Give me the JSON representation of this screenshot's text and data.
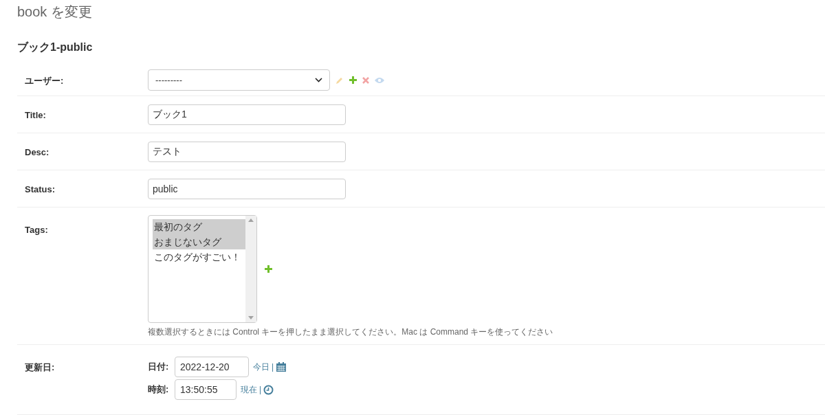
{
  "page_title": "book を変更",
  "section_title": "ブック1-public",
  "fields": [
    {
      "kind": "select",
      "label": "ユーザー:",
      "value": "---------"
    },
    {
      "kind": "text",
      "label": "Title:",
      "value": "ブック1"
    },
    {
      "kind": "text",
      "label": "Desc:",
      "value": "テスト"
    },
    {
      "kind": "text",
      "label": "Status:",
      "value": "public"
    },
    {
      "kind": "multiselect",
      "label": "Tags:",
      "options": [
        {
          "label": "最初のタグ",
          "selected": true
        },
        {
          "label": "おまじないタグ",
          "selected": true
        },
        {
          "label": "このタグがすごい！",
          "selected": false
        }
      ],
      "help": "複数選択するときには Control キーを押したまま選択してください。Mac は Command キーを使ってください"
    },
    {
      "kind": "datetime",
      "label": "更新日:",
      "date_label": "日付:",
      "date": "2022-12-20",
      "today_link": "今日",
      "date_separator": "|",
      "time_label": "時刻:",
      "time": "13:50:55",
      "now_link": "現在",
      "time_separator": "|"
    }
  ]
}
